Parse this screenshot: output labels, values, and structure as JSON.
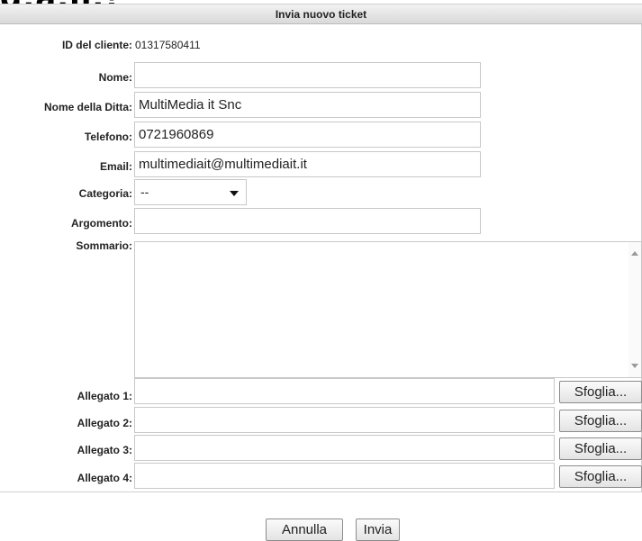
{
  "top_cut_text": "g.a.n.!",
  "form": {
    "title": "Invia nuovo ticket",
    "client_id_label": "ID del cliente:",
    "client_id_value": "01317580411",
    "name_label": "Nome:",
    "name_value": "",
    "company_label": "Nome della Ditta:",
    "company_value": "MultiMedia it Snc",
    "phone_label": "Telefono:",
    "phone_value": "0721960869",
    "email_label": "Email:",
    "email_value": "multimediait@multimediait.it",
    "category_label": "Categoria:",
    "category_value": "--",
    "subject_label": "Argomento:",
    "subject_value": "",
    "summary_label": "Sommario:",
    "attachments": [
      {
        "label": "Allegato 1:",
        "button": "Sfoglia..."
      },
      {
        "label": "Allegato 2:",
        "button": "Sfoglia..."
      },
      {
        "label": "Allegato 3:",
        "button": "Sfoglia..."
      },
      {
        "label": "Allegato 4:",
        "button": "Sfoglia..."
      }
    ]
  },
  "actions": {
    "cancel_label": "Annulla",
    "submit_label": "Invia"
  }
}
